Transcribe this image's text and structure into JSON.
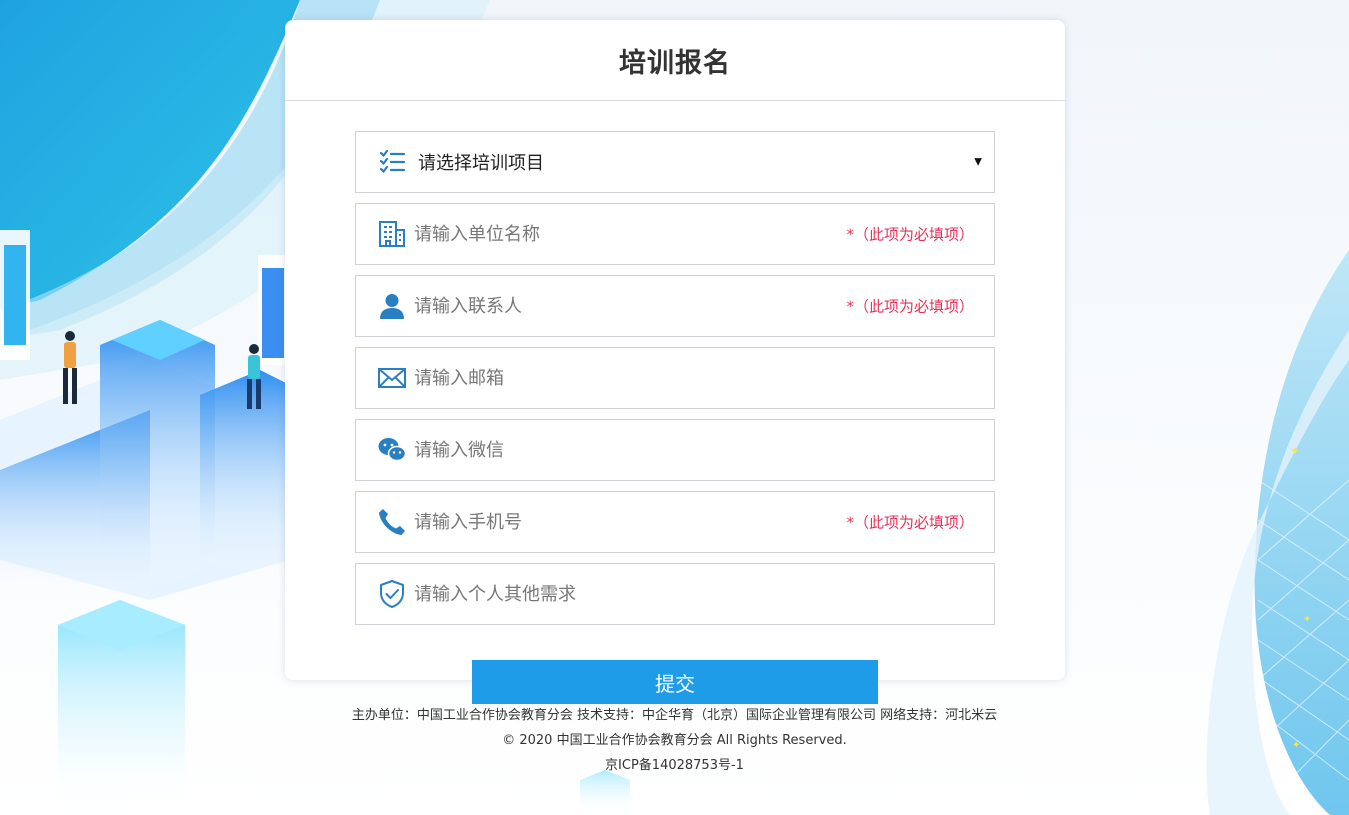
{
  "page": {
    "title": "培训报名"
  },
  "form": {
    "project_select": {
      "placeholder": "请选择培训项目",
      "caret": "▼",
      "icon": "checklist-icon"
    },
    "fields": [
      {
        "placeholder": "请输入单位名称",
        "required_note": "*（此项为必填项）",
        "icon": "building-icon"
      },
      {
        "placeholder": "请输入联系人",
        "required_note": "*（此项为必填项）",
        "icon": "user-icon"
      },
      {
        "placeholder": "请输入邮箱",
        "icon": "mail-icon"
      },
      {
        "placeholder": "请输入微信",
        "icon": "wechat-icon"
      },
      {
        "placeholder": "请输入手机号",
        "required_note": "*（此项为必填项）",
        "icon": "phone-icon"
      },
      {
        "placeholder": "请输入个人其他需求",
        "icon": "shield-check-icon"
      }
    ],
    "submit_label": "提交"
  },
  "footer": {
    "line1": "主办单位：中国工业合作协会教育分会 技术支持：中企华育（北京）国际企业管理有限公司 网络支持：河北米云",
    "line2": "© 2020 中国工业合作协会教育分会 All Rights Reserved.",
    "line3": "京ICP备14028753号-1"
  },
  "colors": {
    "accent": "#1f9ce8",
    "icon": "#2a7fc0",
    "required": "#e8325a"
  }
}
